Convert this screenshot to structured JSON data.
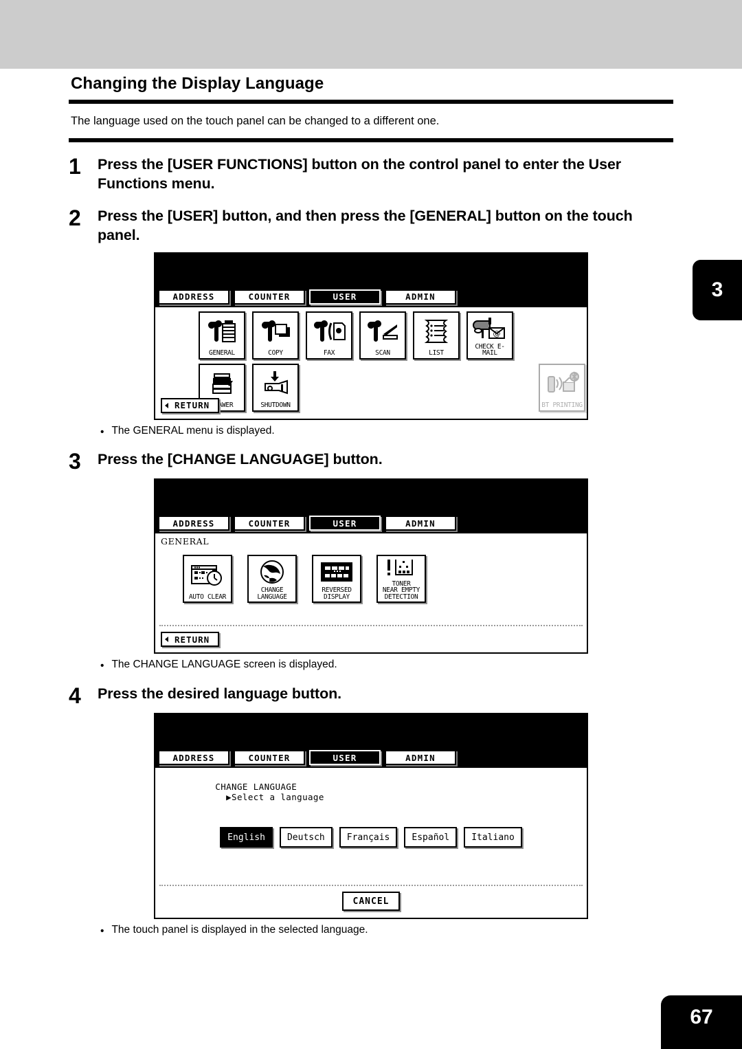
{
  "page": {
    "chapter_marker": "3",
    "page_number": "67",
    "section_title": "Changing the Display Language",
    "intro": "The language used on the touch panel can be changed to a different one."
  },
  "steps": [
    {
      "number": "1",
      "text": "Press the [USER FUNCTIONS] button on the control panel to enter the User Functions menu."
    },
    {
      "number": "2",
      "text": "Press the [USER] button, and then press the [GENERAL] button on the touch panel."
    },
    {
      "number": "3",
      "text": "Press the [CHANGE LANGUAGE] button."
    },
    {
      "number": "4",
      "text": "Press the desired language button."
    }
  ],
  "notes": {
    "after_step2": "The GENERAL menu is displayed.",
    "after_step3": "The CHANGE LANGUAGE screen is displayed.",
    "after_step4": "The touch panel is displayed in the selected language."
  },
  "panels": {
    "user_menu": {
      "tabs": [
        {
          "label": "ADDRESS",
          "active": false
        },
        {
          "label": "COUNTER",
          "active": false
        },
        {
          "label": "USER",
          "active": true
        },
        {
          "label": "ADMIN",
          "active": false
        }
      ],
      "row1": [
        {
          "label": "GENERAL",
          "icon": "wrench-copier-icon",
          "disabled": false
        },
        {
          "label": "COPY",
          "icon": "wrench-paper-icon",
          "disabled": false
        },
        {
          "label": "FAX",
          "icon": "wrench-fax-icon",
          "disabled": false
        },
        {
          "label": "SCAN",
          "icon": "wrench-scanner-icon",
          "disabled": false
        },
        {
          "label": "LIST",
          "icon": "list-pages-icon",
          "disabled": false
        },
        {
          "label": "CHECK E-MAIL",
          "icon": "mailbox-at-icon",
          "disabled": false
        }
      ],
      "row2": [
        {
          "label": "DRAWER",
          "icon": "copier-drawer-icon",
          "disabled": false
        },
        {
          "label": "SHUTDOWN",
          "icon": "shutdown-switch-icon",
          "disabled": false
        }
      ],
      "row2_right": {
        "label": "BT PRINTING",
        "icon": "bluetooth-printing-icon",
        "disabled": true
      },
      "return_label": "RETURN"
    },
    "general_menu": {
      "tabs": [
        {
          "label": "ADDRESS",
          "active": false
        },
        {
          "label": "COUNTER",
          "active": false
        },
        {
          "label": "USER",
          "active": true
        },
        {
          "label": "ADMIN",
          "active": false
        }
      ],
      "breadcrumb": "GENERAL",
      "buttons": [
        {
          "label": "AUTO CLEAR",
          "icon": "screen-stopwatch-icon"
        },
        {
          "label": "CHANGE\nLANGUAGE",
          "icon": "globe-icon"
        },
        {
          "label": "REVERSED\nDISPLAY",
          "icon": "reversed-panel-icon"
        },
        {
          "label": "TONER\nNEAR EMPTY\nDETECTION",
          "icon": "toner-alert-icon"
        }
      ],
      "return_label": "RETURN"
    },
    "change_language": {
      "tabs": [
        {
          "label": "ADDRESS",
          "active": false
        },
        {
          "label": "COUNTER",
          "active": false
        },
        {
          "label": "USER",
          "active": true
        },
        {
          "label": "ADMIN",
          "active": false
        }
      ],
      "breadcrumb": "CHANGE LANGUAGE",
      "prompt": "Select a language",
      "languages": [
        {
          "label": "English",
          "selected": true
        },
        {
          "label": "Deutsch",
          "selected": false
        },
        {
          "label": "Français",
          "selected": false
        },
        {
          "label": "Español",
          "selected": false
        },
        {
          "label": "Italiano",
          "selected": false
        }
      ],
      "cancel_label": "CANCEL"
    }
  },
  "colors": {
    "top_band": "#cccccc",
    "ink": "#000000",
    "disabled": "#b0b0b0"
  }
}
